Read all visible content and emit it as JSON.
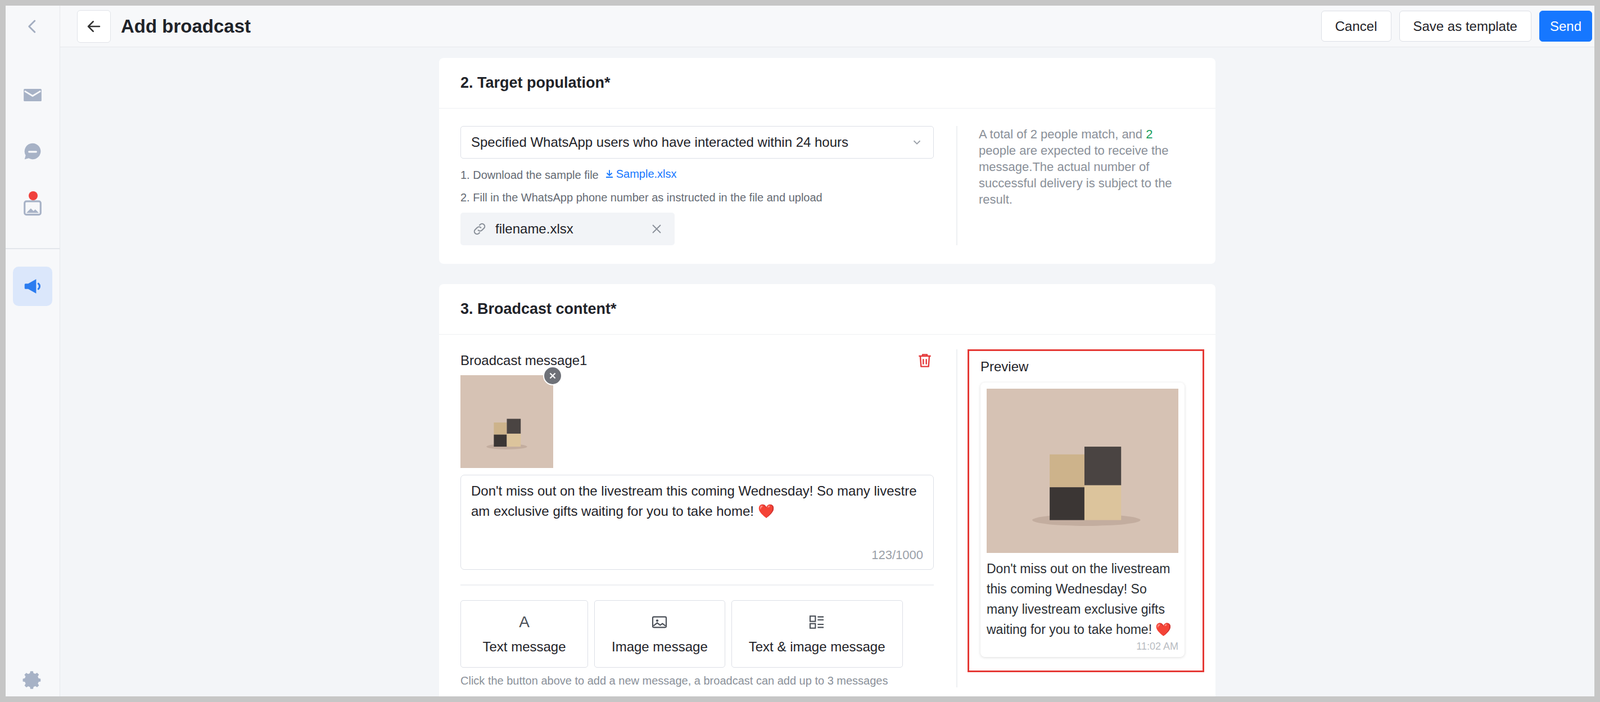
{
  "window": {
    "title": "Add broadcast"
  },
  "header": {
    "buttons": [
      {
        "label": "Cancel",
        "primary": false
      },
      {
        "label": "Save as template",
        "primary": false
      },
      {
        "label": "Send",
        "primary": true
      }
    ]
  },
  "sidebar": {
    "groups": [
      [
        {
          "kind": "mail",
          "selected": false,
          "badge": false
        },
        {
          "kind": "chat",
          "selected": false,
          "badge": false
        },
        {
          "kind": "gallery",
          "selected": false,
          "badge": true
        }
      ],
      [
        {
          "kind": "megaphone",
          "selected": true,
          "badge": false
        }
      ]
    ]
  },
  "target": {
    "title": "2. Target population*",
    "select": "Specified WhatsApp users who have interacted within 24 hours",
    "step1": "1. Download the sample file",
    "sample_link": "Sample.xlsx",
    "step2": "2. Fill in the WhatsApp phone number as instructed in the file and upload",
    "file": "filename.xlsx",
    "summary_before": "A total of 2 people match, and ",
    "summary_count": "2",
    "summary_after": " people are expected to receive the message.The actual number of successful delivery is subject to the result."
  },
  "content": {
    "title": "3. Broadcast content*",
    "messages": [
      {
        "label": "Broadcast message1",
        "text": "Don't miss out on the livestream this coming Wednesday! So many livestream exclusive gifts waiting for you to take home! ❤️",
        "counter": "123/1000"
      }
    ],
    "add_buttons": [
      {
        "label": "Text message",
        "kind": "text",
        "icon": "A"
      },
      {
        "label": "Image message",
        "kind": "image",
        "icon": ""
      },
      {
        "label": "Text & image message",
        "kind": "mixed",
        "icon": ""
      }
    ],
    "hint": "Click the button above to add a new message, a broadcast can add up to 3 messages"
  },
  "preview": {
    "title": "Preview",
    "text": "Don't miss out on the livestream this coming Wednesday! So many livestream exclusive gifts waiting for you to take home! ❤️",
    "time": "11:02 AM",
    "highlighted": true
  }
}
